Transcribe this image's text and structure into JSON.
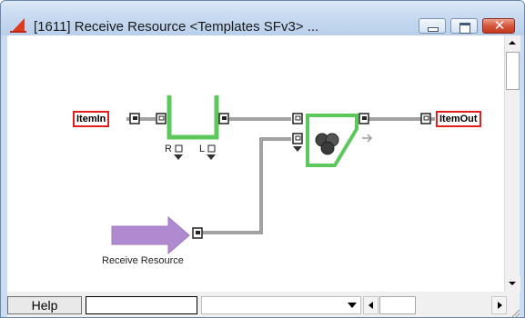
{
  "window": {
    "title": "[1611]  Receive Resource   <Templates SFv3>  ...",
    "minimize_icon": "minimize-icon",
    "maximize_icon": "maximize-icon",
    "close_icon": "close-icon",
    "close_glyph": "✕",
    "app_icon": "triangle-app-icon"
  },
  "diagram": {
    "item_in_label": "ItemIn",
    "item_out_label": "ItemOut",
    "receive_resource_caption": "Receive Resource",
    "queue_r_label": "R",
    "queue_l_label": "L",
    "colors": {
      "port_border": "#e02020",
      "block_outline": "#5cc85c",
      "arrow_fill": "#b08ad0",
      "wire": "#444444"
    }
  },
  "bottombar": {
    "help_label": "Help",
    "status_value": "",
    "combo_value": ""
  }
}
